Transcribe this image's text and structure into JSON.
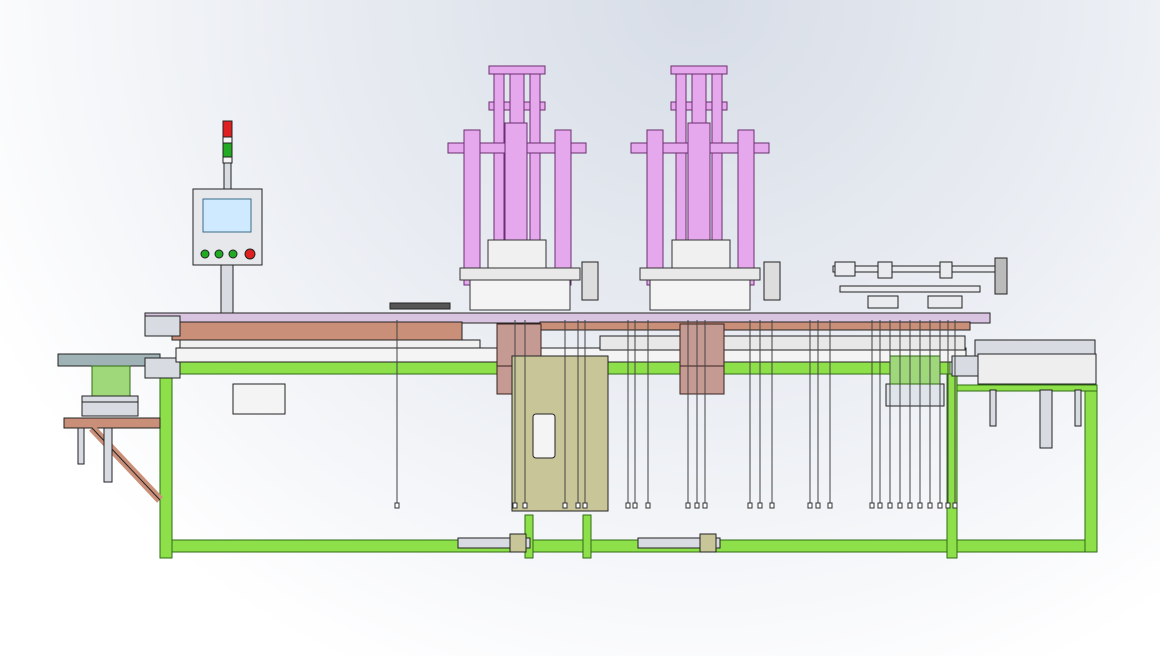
{
  "drawing": {
    "view": "side-elevation",
    "colors": {
      "background_top": "#d7dde7",
      "frame": "#8ee04a",
      "frame_edge": "#2f6b14",
      "press": "#e6a8ec",
      "press_edge": "#6a2f70",
      "mold_block": "#c49a93",
      "mold_edge": "#3a2220",
      "panel": "#c8c699",
      "conveyor": "#c98f78",
      "steel": "#d8dce2",
      "line": "#222222",
      "hmi_screen": "#cfe9ff",
      "lamp_red": "#e02020",
      "lamp_green": "#22aa22"
    },
    "components": {
      "control_panel": {
        "buttons": 4,
        "tower_light": [
          "red",
          "green",
          "white"
        ]
      },
      "press_stations": 2,
      "hanging_rods": 28
    }
  }
}
